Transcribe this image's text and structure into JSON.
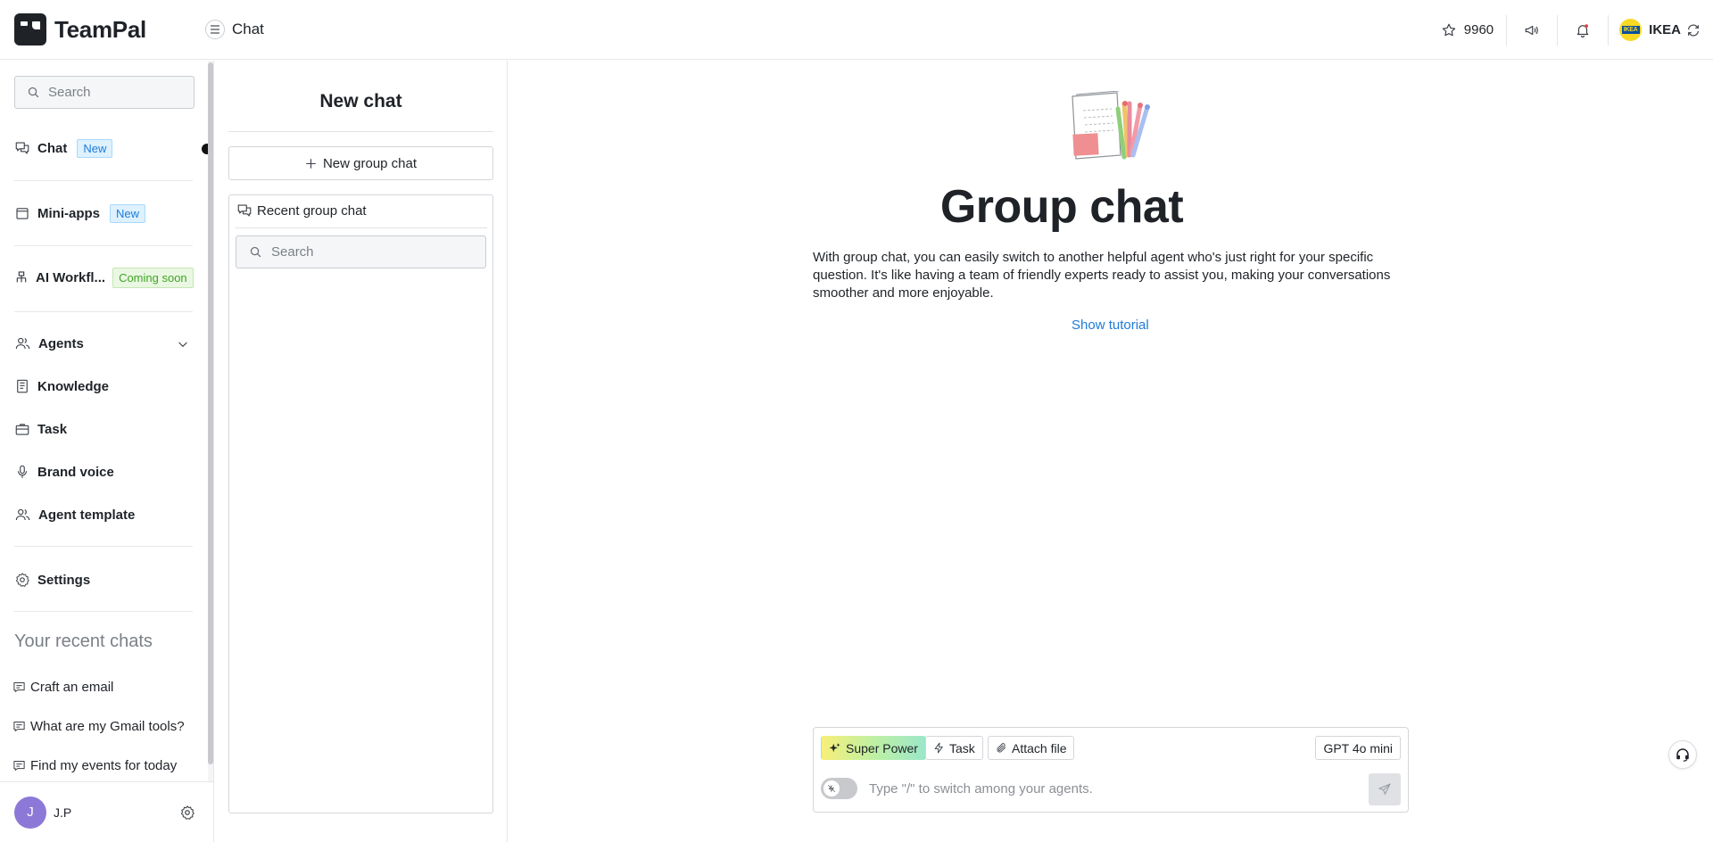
{
  "header": {
    "brand": "TeamPal",
    "page_title": "Chat",
    "credits": "9960",
    "org_name": "IKEA",
    "org_logo_text": "IKEA"
  },
  "sidebar": {
    "search_placeholder": "Search",
    "items": [
      {
        "label": "Chat",
        "badge": "New",
        "icon": "chat-icon"
      },
      {
        "label": "Mini-apps",
        "badge": "New",
        "icon": "calendar-icon"
      },
      {
        "label": "AI Workfl...",
        "badge": "Coming soon",
        "icon": "workflow-icon"
      },
      {
        "label": "Agents",
        "icon": "users-icon"
      },
      {
        "label": "Knowledge",
        "icon": "book-icon"
      },
      {
        "label": "Task",
        "icon": "briefcase-icon"
      },
      {
        "label": "Brand voice",
        "icon": "microphone-icon"
      },
      {
        "label": "Agent template",
        "icon": "users-icon"
      },
      {
        "label": "Settings",
        "icon": "gear-icon"
      }
    ],
    "recent_title": "Your recent chats",
    "recent_chats": [
      "Craft an email",
      "What are my Gmail tools?",
      "Find my events for today"
    ],
    "user": {
      "initial": "J",
      "name": "J.P"
    }
  },
  "middle": {
    "title": "New chat",
    "new_group_button": "New group chat",
    "recent_group_title": "Recent group chat",
    "search_placeholder": "Search"
  },
  "main": {
    "title": "Group chat",
    "description": "With group chat, you can easily switch to another helpful agent who's just right for your specific question. It's like having a team of friendly experts ready to assist you, making your conversations smoother and more enjoyable.",
    "tutorial_link": "Show tutorial",
    "composer": {
      "super_power": "Super Power",
      "task": "Task",
      "attach": "Attach file",
      "model": "GPT 4o mini",
      "placeholder": "Type \"/\" to switch among your agents."
    }
  },
  "colors": {
    "accent_blue": "#1f7bd8",
    "badge_new_bg": "#ddf1ff",
    "badge_soon_text": "#3fa524",
    "avatar": "#8c79d7",
    "text": "#1f2328"
  }
}
